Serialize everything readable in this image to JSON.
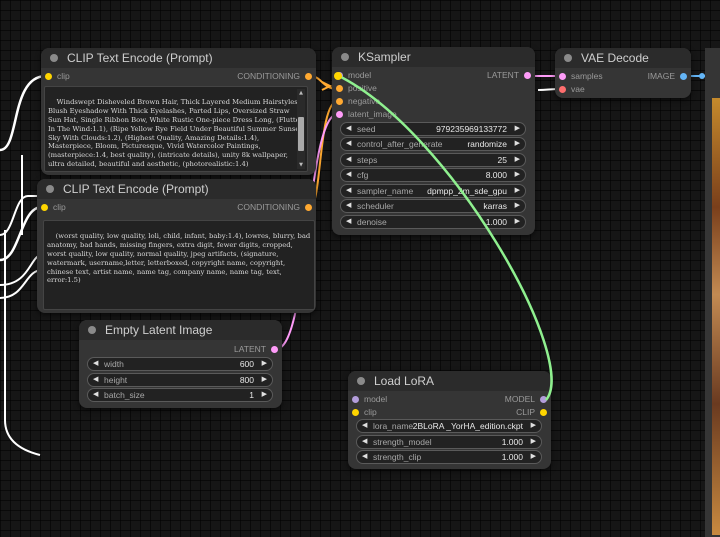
{
  "colors": {
    "conditioning": "#ffa931",
    "latent": "#ff9cf9",
    "model": "#b39ddb",
    "clip": "#ffd500",
    "vae": "#ff6e6e",
    "image": "#64b5f6",
    "wire_green": "#8ff08f"
  },
  "clip_top": {
    "title": "CLIP Text Encode (Prompt)",
    "input_clip": "clip",
    "output": "CONDITIONING",
    "text": "Windswept Disheveled Brown Hair, Thick Layered Medium Hairstyles, Blush Eyeshadow With Thick Eyelashes, Parted Lips, Oversized Straw Sun Hat, Single Ribbon Bow, White Rustic One-piece Dress Long, (Flutter In The Wind:1.1), (Ripe Yellow Rye Field Under Beautiful Summer Sunset Sky With Clouds:1.2), (Highest Quality, Amazing Details:1.4), Masterpiece, Bloom, Picturesque, Vivid Watercolor Paintings,(masterpiece:1.4, best quality), (intricate details), unity 8k wallpaper, ultra detailed, beautiful and aesthetic, (photorealistic:1.4)"
  },
  "clip_bottom": {
    "title": "CLIP Text Encode (Prompt)",
    "input_clip": "clip",
    "output": "CONDITIONING",
    "text": "(worst quality, low quality, loli, child, infant, baby:1.4), lowres, blurry, bad anatomy, bad hands, missing fingers, extra digit, fewer digits, cropped, worst quality, low quality, normal quality, jpeg artifacts, (signature, watermark, username,letter, letterboxed, copyright name, copyright, chinese text, artist name, name tag, company name, name tag, text, error:1.5)"
  },
  "ksampler": {
    "title": "KSampler",
    "inputs": [
      "model",
      "positive",
      "negative",
      "latent_image"
    ],
    "output": "LATENT",
    "widgets": [
      {
        "label": "seed",
        "value": "979235969133772"
      },
      {
        "label": "control_after_generate",
        "value": "randomize"
      },
      {
        "label": "steps",
        "value": "25"
      },
      {
        "label": "cfg",
        "value": "8.000"
      },
      {
        "label": "sampler_name",
        "value": "dpmpp_2m_sde_gpu"
      },
      {
        "label": "scheduler",
        "value": "karras"
      },
      {
        "label": "denoise",
        "value": "1.000"
      }
    ]
  },
  "vae_decode": {
    "title": "VAE Decode",
    "inputs": [
      "samples",
      "vae"
    ],
    "output": "IMAGE"
  },
  "empty_latent": {
    "title": "Empty Latent Image",
    "output": "LATENT",
    "widgets": [
      {
        "label": "width",
        "value": "600"
      },
      {
        "label": "height",
        "value": "800"
      },
      {
        "label": "batch_size",
        "value": "1"
      }
    ]
  },
  "load_lora": {
    "title": "Load LoRA",
    "inputs": [
      "model",
      "clip"
    ],
    "outputs": [
      "MODEL",
      "CLIP"
    ],
    "widgets": [
      {
        "label": "lora_name",
        "value": "2BLoRA _YorHA_edition.ckpt"
      },
      {
        "label": "strength_model",
        "value": "1.000"
      },
      {
        "label": "strength_clip",
        "value": "1.000"
      }
    ]
  },
  "icons": {
    "arrow_left": "◀",
    "arrow_right": "▶",
    "scroll_up": "▲",
    "scroll_down": "▼"
  }
}
